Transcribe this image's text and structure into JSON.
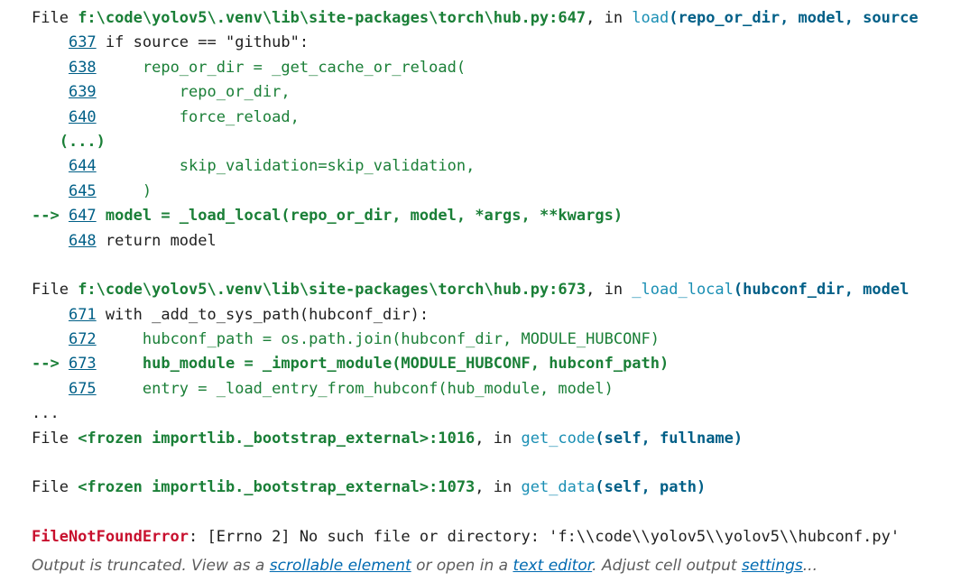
{
  "frames": [
    {
      "file_prefix": "File ",
      "file_path": "f:\\code\\yolov5\\.venv\\lib\\site-packages\\torch\\hub.py:647",
      "in_text": ", in ",
      "func": "load",
      "args": "(repo_or_dir, model, source",
      "lines": [
        {
          "marker": "    ",
          "num": "637",
          "indent": " ",
          "code": "if source == \"github\":",
          "style": "plain"
        },
        {
          "marker": "    ",
          "num": "638",
          "indent": "     ",
          "code": "repo_or_dir = _get_cache_or_reload(",
          "style": "green"
        },
        {
          "marker": "    ",
          "num": "639",
          "indent": "         ",
          "code": "repo_or_dir,",
          "style": "green"
        },
        {
          "marker": "    ",
          "num": "640",
          "indent": "         ",
          "code": "force_reload,",
          "style": "green"
        },
        {
          "marker": "   ",
          "num": "",
          "indent": "",
          "code": "(...)",
          "style": "ellipsis"
        },
        {
          "marker": "    ",
          "num": "644",
          "indent": "         ",
          "code": "skip_validation=skip_validation,",
          "style": "green"
        },
        {
          "marker": "    ",
          "num": "645",
          "indent": "     ",
          "code": ")",
          "style": "green"
        },
        {
          "marker": "--> ",
          "num": "647",
          "indent": " ",
          "code": "model = _load_local(repo_or_dir, model, *args, **kwargs)",
          "style": "current"
        },
        {
          "marker": "    ",
          "num": "648",
          "indent": " ",
          "code": "return model",
          "style": "plain"
        }
      ]
    },
    {
      "file_prefix": "File ",
      "file_path": "f:\\code\\yolov5\\.venv\\lib\\site-packages\\torch\\hub.py:673",
      "in_text": ", in ",
      "func": "_load_local",
      "args": "(hubconf_dir, model",
      "lines": [
        {
          "marker": "    ",
          "num": "671",
          "indent": " ",
          "code": "with _add_to_sys_path(hubconf_dir):",
          "style": "plain"
        },
        {
          "marker": "    ",
          "num": "672",
          "indent": "     ",
          "code": "hubconf_path = os.path.join(hubconf_dir, MODULE_HUBCONF)",
          "style": "green"
        },
        {
          "marker": "--> ",
          "num": "673",
          "indent": "     ",
          "code": "hub_module = _import_module(MODULE_HUBCONF, hubconf_path)",
          "style": "current"
        },
        {
          "marker": "    ",
          "num": "675",
          "indent": "     ",
          "code": "entry = _load_entry_from_hubconf(hub_module, model)",
          "style": "green"
        }
      ]
    }
  ],
  "skip": "...",
  "frozen": [
    {
      "file_prefix": "File ",
      "file_path": "<frozen importlib._bootstrap_external>:1016",
      "in_text": ", in ",
      "func": "get_code",
      "args": "(self, fullname)"
    },
    {
      "file_prefix": "File ",
      "file_path": "<frozen importlib._bootstrap_external>:1073",
      "in_text": ", in ",
      "func": "get_data",
      "args": "(self, path)"
    }
  ],
  "error": {
    "type": "FileNotFoundError",
    "message": ": [Errno 2] No such file or directory: 'f:\\\\code\\\\yolov5\\\\yolov5\\\\hubconf.py'"
  },
  "footer": {
    "text1": "Output is truncated. View as a ",
    "link1": "scrollable element",
    "text2": " or open in a ",
    "link2": "text editor",
    "text3": ". Adjust cell output ",
    "link3": "settings",
    "text4": "..."
  }
}
